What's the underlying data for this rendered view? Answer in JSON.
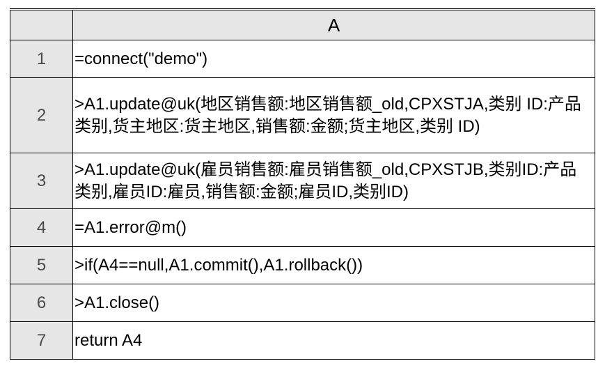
{
  "table": {
    "headers": {
      "corner": "",
      "A": "A"
    },
    "rows": [
      {
        "n": "1",
        "a": "=connect(\"demo\")",
        "cls": "rsingle"
      },
      {
        "n": "2",
        "a": ">A1.update@uk(地区销售额:地区销售额_old,CPXSTJA,类别 ID:产品类别,货主地区:货主地区,销售额:金额;货主地区,类别 ID)",
        "cls": "rtriple"
      },
      {
        "n": "3",
        "a": ">A1.update@uk(雇员销售额:雇员销售额_old,CPXSTJB,类别ID:产品类别,雇员ID:雇员,销售额:金额;雇员ID,类别ID)",
        "cls": "rdouble"
      },
      {
        "n": "4",
        "a": "=A1.error@m()",
        "cls": "rsingle"
      },
      {
        "n": "5",
        "a": ">if(A4==null,A1.commit(),A1.rollback())",
        "cls": "rsingle"
      },
      {
        "n": "6",
        "a": ">A1.close()",
        "cls": "rsingle"
      },
      {
        "n": "7",
        "a": "return A4",
        "cls": "rsingle"
      }
    ]
  }
}
